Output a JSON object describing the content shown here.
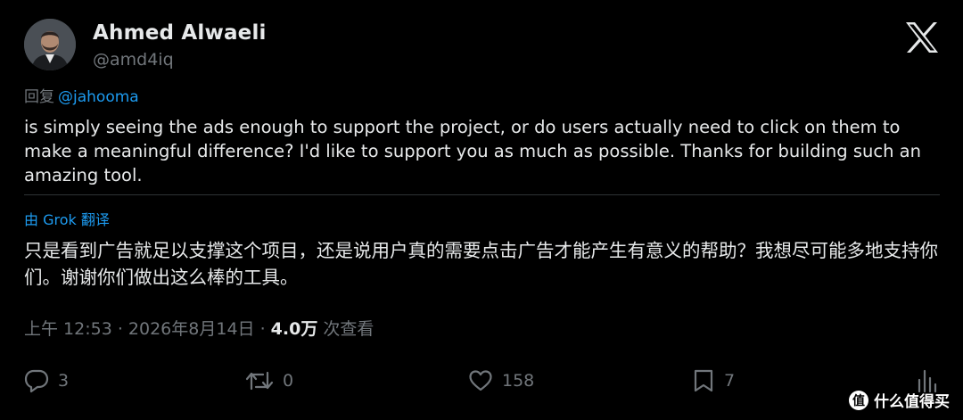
{
  "author": {
    "display_name": "Ahmed Alwaeli",
    "handle": "@amd4iq",
    "avatar_icon": "avatar-photo"
  },
  "platform": {
    "logo_icon": "x-logo-icon"
  },
  "reply": {
    "prefix": "回复",
    "mention": "@jahooma"
  },
  "tweet": {
    "text": "is simply seeing the ads enough to support the project, or do users actually need to click on them to make a meaningful difference?  I'd like to support you as much as possible. Thanks for building such an amazing tool."
  },
  "translation": {
    "label": "由 Grok 翻译",
    "text": "只是看到广告就足以支撑这个项目，还是说用户真的需要点击广告才能产生有意义的帮助？我想尽可能多地支持你们。谢谢你们做出这么棒的工具。"
  },
  "meta": {
    "time": "上午 12:53",
    "separator1": " · ",
    "date": "2026年8月14日",
    "separator2": " · ",
    "views_count": "4.0万",
    "views_label": " 次查看"
  },
  "actions": {
    "replies": "3",
    "retweets": "0",
    "likes": "158",
    "bookmarks": "7"
  },
  "watermark": {
    "badge": "值",
    "text": "什么值得买"
  },
  "colors": {
    "background": "#000000",
    "text_primary": "#e7e9ea",
    "text_secondary": "#71767b",
    "accent": "#1d9bf0",
    "divider": "#2f3336"
  }
}
